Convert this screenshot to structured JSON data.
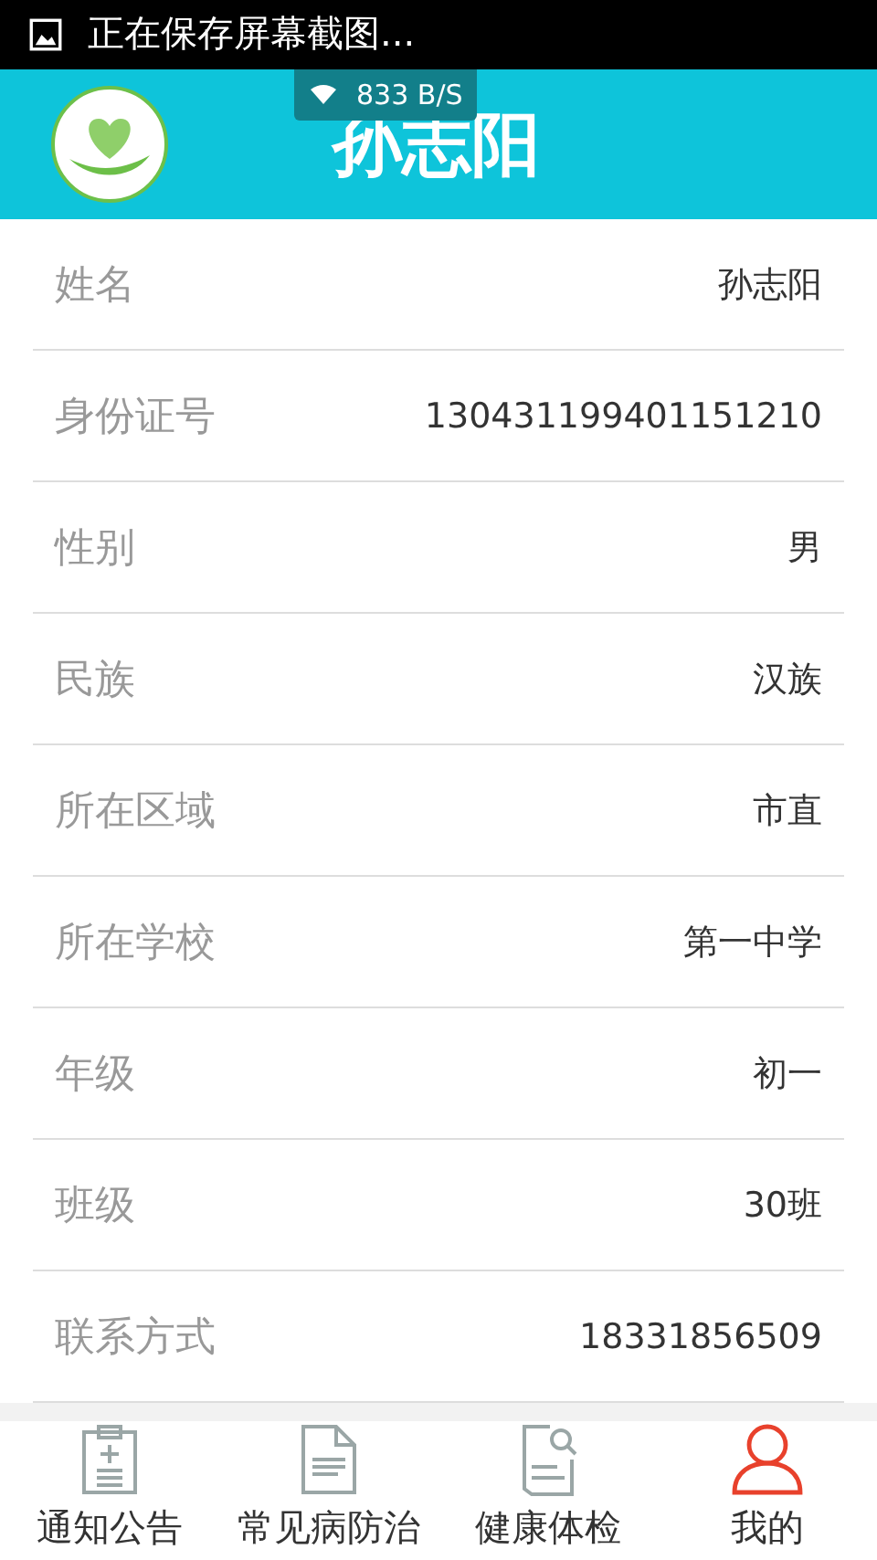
{
  "status_bar": {
    "notification": "正在保存屏幕截图..."
  },
  "speed_overlay": {
    "text": "833 B/S"
  },
  "header": {
    "title": "孙志阳"
  },
  "fields": [
    {
      "label": "姓名",
      "value": "孙志阳"
    },
    {
      "label": "身份证号",
      "value": "130431199401151210"
    },
    {
      "label": "性别",
      "value": "男"
    },
    {
      "label": "民族",
      "value": "汉族"
    },
    {
      "label": "所在区域",
      "value": "市直"
    },
    {
      "label": "所在学校",
      "value": "第一中学"
    },
    {
      "label": "年级",
      "value": "初一"
    },
    {
      "label": "班级",
      "value": "30班"
    },
    {
      "label": "联系方式",
      "value": "18331856509"
    }
  ],
  "tabs": [
    {
      "kind": "clipboard",
      "label": "通知公告",
      "selected": false
    },
    {
      "kind": "document",
      "label": "常见病防治",
      "selected": false
    },
    {
      "kind": "search-doc",
      "label": "健康体检",
      "selected": false
    },
    {
      "kind": "person",
      "label": "我的",
      "selected": true
    }
  ]
}
